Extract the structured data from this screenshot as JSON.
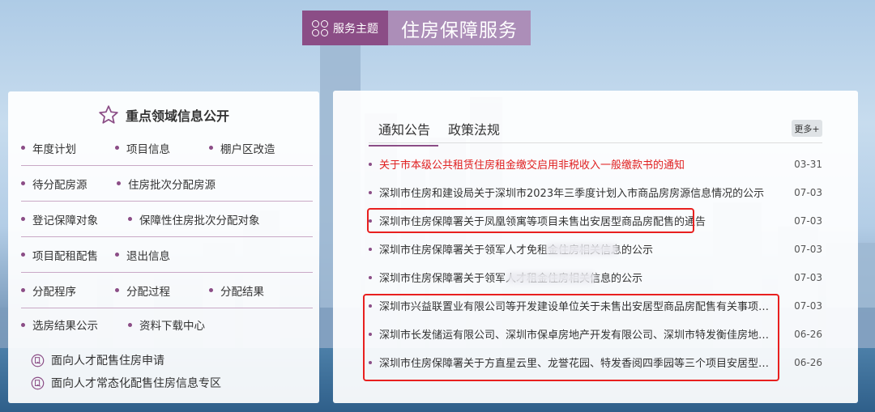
{
  "header": {
    "theme_label": "服务主题",
    "title": "住房保障服务"
  },
  "left_panel": {
    "title": "重点领域信息公开",
    "rows": [
      [
        "年度计划",
        "项目信息",
        "棚户区改造"
      ],
      [
        "待分配房源",
        "住房批次分配房源"
      ],
      [
        "登记保障对象",
        "保障性住房批次分配对象"
      ],
      [
        "项目配租配售",
        "退出信息"
      ],
      [
        "分配程序",
        "分配过程",
        "分配结果"
      ],
      [
        "选房结果公示",
        "资料下载中心"
      ]
    ],
    "extras": [
      "面向人才配售住房申请",
      "面向人才常态化配售住房信息专区"
    ]
  },
  "right_panel": {
    "tabs": [
      "通知公告",
      "政策法规"
    ],
    "more_label": "更多+",
    "news": [
      {
        "title": "关于市本级公共租赁住房租金缴交启用非税收入一般缴款书的通知",
        "date": "03-31",
        "highlight": true
      },
      {
        "title": "深圳市住房和建设局关于深圳市2023年三季度计划入市商品房房源信息情况的公示",
        "date": "07-03"
      },
      {
        "title": "深圳市住房保障署关于凤凰领寓等项目未售出安居型商品房配售的通告",
        "date": "07-03"
      },
      {
        "title": "深圳市住房保障署关于领军人才免租金住房相关信息的公示",
        "date": "07-03"
      },
      {
        "title": "深圳市住房保障署关于领军人才租金住房相关信息的公示",
        "date": "07-03"
      },
      {
        "title": "深圳市兴益联置业有限公司等开发建设单位关于未售出安居型商品房配售有关事项的通知",
        "date": "07-03"
      },
      {
        "title": "深圳市长发储运有限公司、深圳市保卓房地产开发有限公司、深圳市特发衡佳房地产投资...",
        "date": "06-26"
      },
      {
        "title": "深圳市住房保障署关于方直星云里、龙誉花园、特发香阅四季园等三个项目安居型商品房...",
        "date": "06-26"
      }
    ]
  },
  "colors": {
    "accent": "#8b4d86",
    "highlight_red": "#e02020",
    "annotation_box": "#e8201f"
  }
}
